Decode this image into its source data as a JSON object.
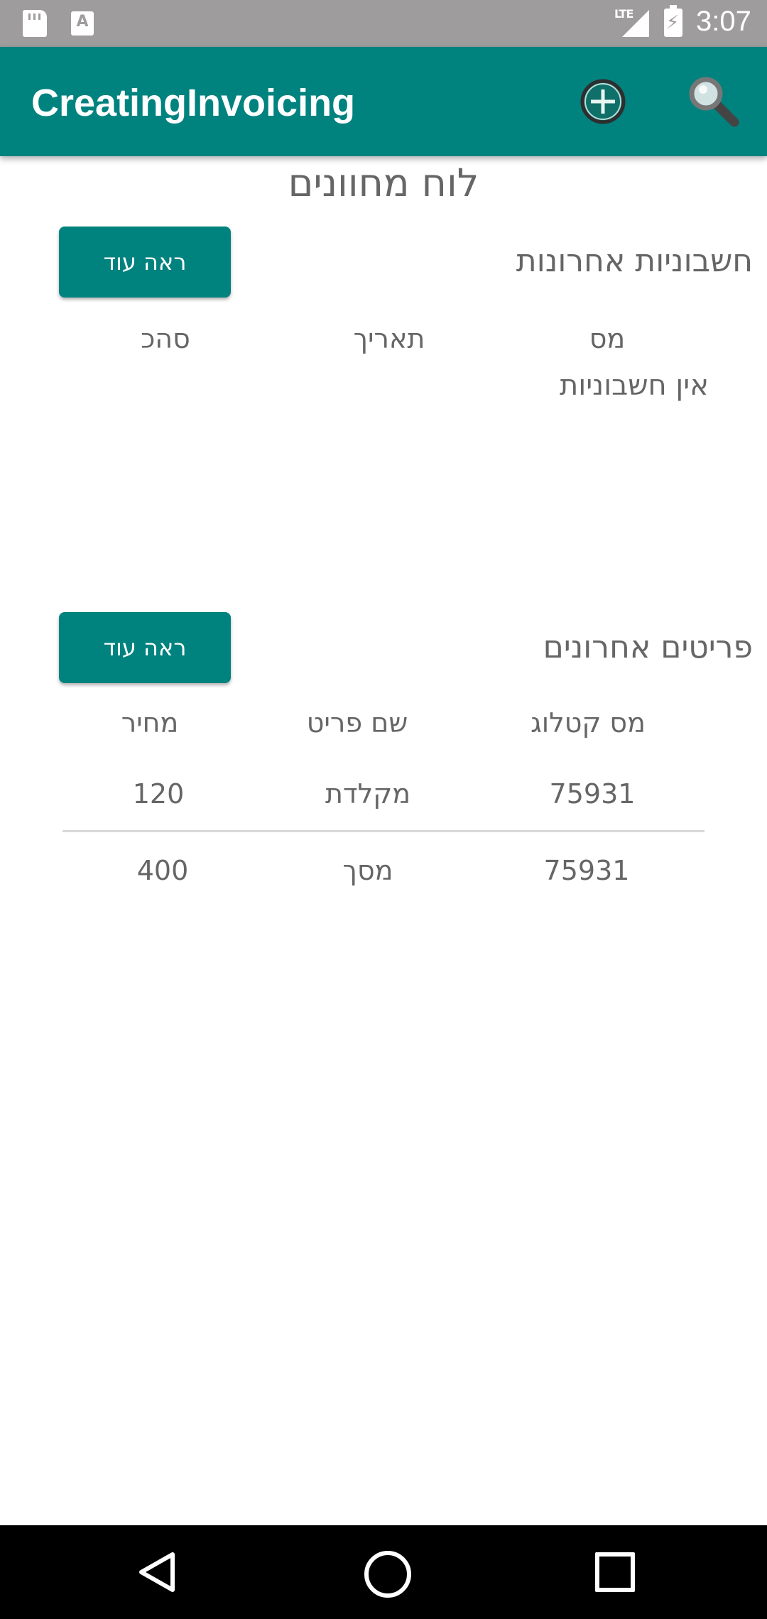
{
  "status_bar": {
    "time": "3:07",
    "network": "LTE",
    "a_icon": "A"
  },
  "app_bar": {
    "title": "CreatingInvoicing"
  },
  "page": {
    "title": "לוח מחוונים"
  },
  "invoices": {
    "title": "חשבוניות אחרונות",
    "see_more": "ראה עוד",
    "columns": {
      "number": "מס",
      "date": "תאריך",
      "total": "סהכ"
    },
    "empty_text": "אין חשבוניות"
  },
  "items": {
    "title": "פריטים אחרונים",
    "see_more": "ראה עוד",
    "columns": {
      "catalog": "מס קטלוג",
      "name": "שם פריט",
      "price": "מחיר"
    },
    "rows": [
      {
        "catalog": "75931",
        "name": "מקלדת",
        "price": "120"
      },
      {
        "catalog": "75931",
        "name": "מסך",
        "price": "400"
      }
    ]
  },
  "colors": {
    "primary": "#00827f",
    "status_bar": "#9e9c9d",
    "text": "#666666"
  }
}
